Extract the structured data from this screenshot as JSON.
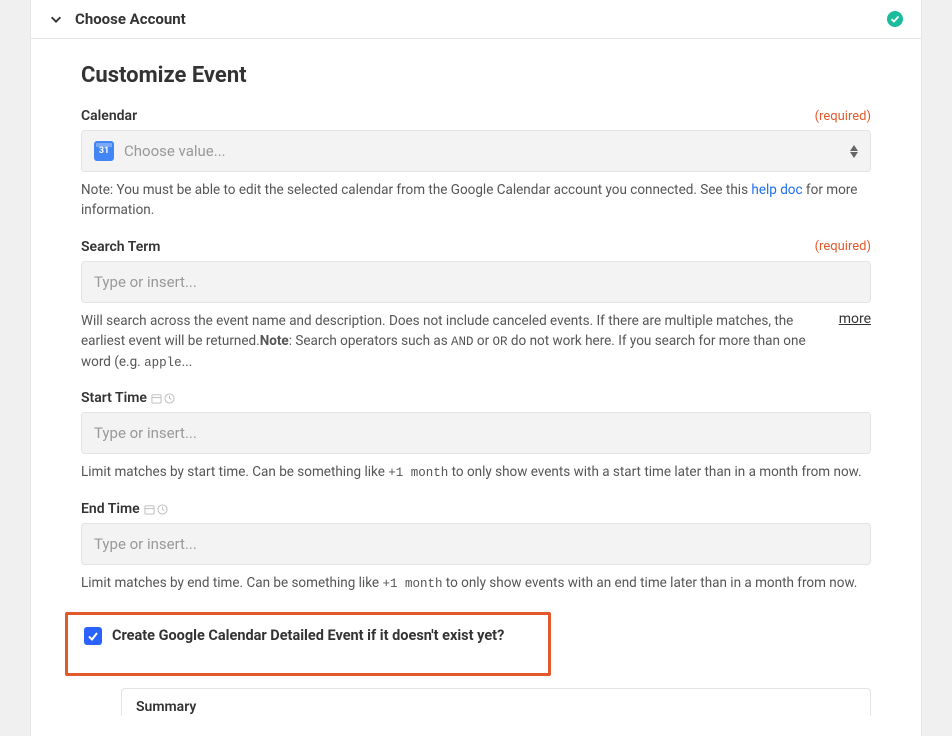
{
  "header": {
    "title": "Choose Account"
  },
  "page": {
    "title": "Customize Event"
  },
  "fields": {
    "calendar": {
      "label": "Calendar",
      "required": "(required)",
      "placeholder": "Choose value...",
      "calIconText": "31",
      "help_prefix": "Note: You must be able to edit the selected calendar from the Google Calendar account you connected. See this ",
      "help_link": "help doc",
      "help_suffix": " for more information."
    },
    "search": {
      "label": "Search Term",
      "required": "(required)",
      "placeholder": "Type or insert...",
      "help_a": "Will search across the event name and description. Does not include canceled events. If there are multiple matches, the earliest event will be returned.",
      "help_bold": "Note",
      "help_b": ": Search operators such as ",
      "help_code1": "AND",
      "help_c": " or ",
      "help_code2": "OR",
      "help_d": " do not work here. If you search for more than one word (e.g. ",
      "help_code3": "apple",
      "help_e": "...",
      "more": "more"
    },
    "start": {
      "label": "Start Time",
      "placeholder": "Type or insert...",
      "help_a": "Limit matches by start time. Can be something like ",
      "help_code": "+1 month",
      "help_b": " to only show events with a start time later than in a month from now."
    },
    "end": {
      "label": "End Time",
      "placeholder": "Type or insert...",
      "help_a": "Limit matches by end time. Can be something like ",
      "help_code": "+1 month",
      "help_b": " to only show events with an end time later than in a month from now."
    },
    "createIfMissing": {
      "label": "Create Google Calendar Detailed Event if it doesn't exist yet?"
    },
    "summary": {
      "label": "Summary"
    }
  }
}
